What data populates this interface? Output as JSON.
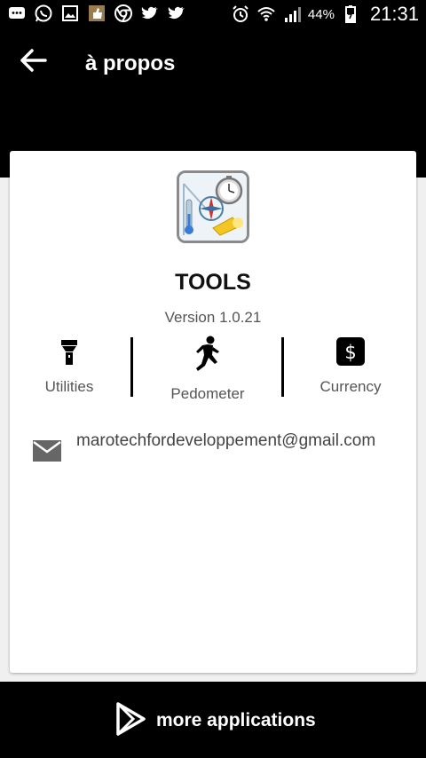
{
  "status_bar": {
    "battery_percent": "44%",
    "time": "21:31",
    "left_icons": [
      "message-icon",
      "whatsapp-icon",
      "gallery-icon",
      "thumb-icon",
      "chrome-icon",
      "twitter-icon",
      "twitter-icon"
    ],
    "right_icons": [
      "alarm-icon",
      "wifi-icon",
      "signal-icon",
      "battery-icon"
    ]
  },
  "app_bar": {
    "title": "à propos",
    "back_icon": "arrow-left-icon"
  },
  "about": {
    "app_name": "TOOLS",
    "version": "Version 1.0.21",
    "features": [
      {
        "label": "Utilities",
        "icon": "flashlight-icon"
      },
      {
        "label": "Pedometer",
        "icon": "runner-icon"
      },
      {
        "label": "Currency",
        "icon": "dollar-icon"
      }
    ],
    "email": "marotechfordeveloppement@gmail.com"
  },
  "bottom_bar": {
    "more_apps_label": "more applications",
    "icon": "play-store-icon"
  },
  "colors": {
    "background": "#000000",
    "card": "#ffffff",
    "text_secondary": "#555555"
  }
}
